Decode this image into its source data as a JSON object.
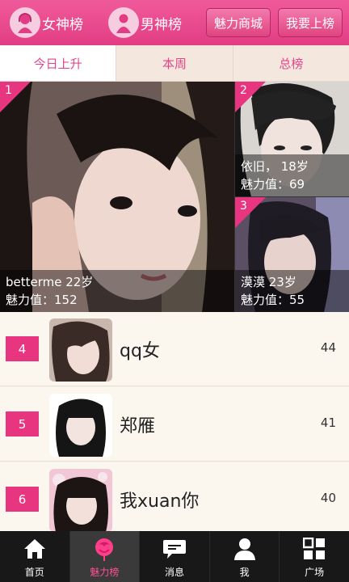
{
  "header": {
    "tabs": [
      {
        "label": "女神榜",
        "icon": "female-avatar-icon"
      },
      {
        "label": "男神榜",
        "icon": "male-avatar-icon"
      }
    ],
    "buttons": {
      "mall": "魅力商城",
      "join": "我要上榜"
    },
    "accent": "#e8357f"
  },
  "segments": [
    {
      "label": "今日上升",
      "active": true
    },
    {
      "label": "本周",
      "active": false
    },
    {
      "label": "总榜",
      "active": false
    }
  ],
  "top_three": [
    {
      "rank": "1",
      "name_age": "betterme 22岁",
      "charm": "魅力值：152"
    },
    {
      "rank": "2",
      "name_age": "依旧， 18岁",
      "charm": "魅力值：69"
    },
    {
      "rank": "3",
      "name_age": "漠漠 23岁",
      "charm": "魅力值：55"
    }
  ],
  "list": [
    {
      "rank": "4",
      "name": "qq女",
      "score": "44"
    },
    {
      "rank": "5",
      "name": "郑雁",
      "score": "41"
    },
    {
      "rank": "6",
      "name": "我xuan你",
      "score": "40"
    }
  ],
  "nav": [
    {
      "label": "首页",
      "icon": "home-icon",
      "active": false
    },
    {
      "label": "魅力榜",
      "icon": "rose-icon",
      "active": true
    },
    {
      "label": "消息",
      "icon": "message-icon",
      "active": false
    },
    {
      "label": "我",
      "icon": "person-icon",
      "active": false
    },
    {
      "label": "广场",
      "icon": "grid-icon",
      "active": false
    }
  ]
}
